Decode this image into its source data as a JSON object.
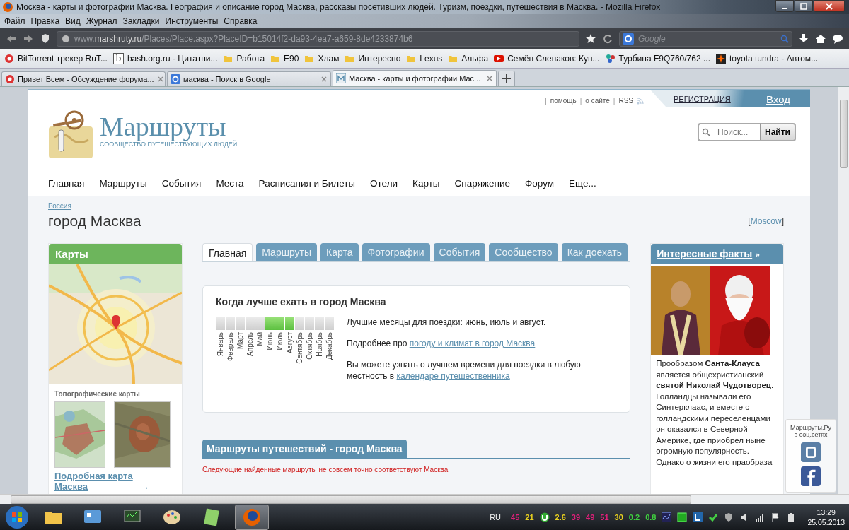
{
  "window": {
    "title": "Москва - карты и фотографии Масква. География и описание город Масква, рассказы посетивших людей. Туризм, поездки, путешествия в Масква. - Mozilla Firefox"
  },
  "menu": [
    "Файл",
    "Правка",
    "Вид",
    "Журнал",
    "Закладки",
    "Инструменты",
    "Справка"
  ],
  "address": {
    "prefix": "www.",
    "domain": "marshruty.ru",
    "path": "/Places/Place.aspx?PlaceID=b15014f2-da93-4ea7-a659-8de4233874b6"
  },
  "web_search": {
    "placeholder": "Google"
  },
  "bookmarks": [
    {
      "label": "BitTorrent трекер RuT...",
      "kind": "flower"
    },
    {
      "label": "bash.org.ru - Цитатни...",
      "kind": "letter",
      "glyph": "b"
    },
    {
      "label": "Работа",
      "kind": "folder"
    },
    {
      "label": "E90",
      "kind": "folder"
    },
    {
      "label": "Хлам",
      "kind": "folder"
    },
    {
      "label": "Интересно",
      "kind": "folder"
    },
    {
      "label": "Lexus",
      "kind": "folder"
    },
    {
      "label": "Альфа",
      "kind": "folder"
    },
    {
      "label": "Семён Слепаков: Куп...",
      "kind": "video"
    },
    {
      "label": "Турбина F9Q760/762 ...",
      "kind": "dots"
    },
    {
      "label": "toyota tundra - Автом...",
      "kind": "star"
    }
  ],
  "tabs": [
    {
      "label": "Привет Всем - Обсуждение форума...",
      "kind": "flower",
      "selected": false
    },
    {
      "label": "масква - Поиск в Google",
      "kind": "google",
      "selected": false
    },
    {
      "label": "Масква - карты и фотографии Мас...",
      "kind": "site",
      "selected": true
    }
  ],
  "site": {
    "separator": "|",
    "top_links": [
      "помощь",
      "о сайте",
      "RSS"
    ],
    "register": "РЕГИСТРАЦИЯ",
    "login": "Вход",
    "logo": "Маршруты",
    "tagline": "СООБЩЕСТВО ПУТЕШЕСТВУЮЩИХ ЛЮДЕЙ",
    "search": {
      "placeholder": "Поиск...",
      "button": "Найти"
    },
    "nav": [
      "Главная",
      "Маршруты",
      "События",
      "Места",
      "Расписания и Билеты",
      "Отели",
      "Карты",
      "Снаряжение",
      "Форум",
      "Еще..."
    ],
    "breadcrumb": "Россия",
    "heading": "город Масква",
    "alt_name": {
      "open": "[",
      "link": "Moscow",
      "close": "]"
    }
  },
  "maps_box": {
    "title": "Карты",
    "topo_title": "Топографические карты",
    "link": "Подробная карта Масква",
    "link_arrow": "→"
  },
  "place_tabs": [
    {
      "label": "Главная",
      "selected": true
    },
    {
      "label": "Маршруты",
      "selected": false
    },
    {
      "label": "Карта",
      "selected": false
    },
    {
      "label": "Фотографии",
      "selected": false
    },
    {
      "label": "События",
      "selected": false
    },
    {
      "label": "Сообщество",
      "selected": false
    },
    {
      "label": "Как доехать",
      "selected": false
    }
  ],
  "best_time": {
    "title": "Когда лучше ехать в город Масква",
    "months": [
      {
        "label": "Январь",
        "best": false
      },
      {
        "label": "Февраль",
        "best": false
      },
      {
        "label": "Март",
        "best": false
      },
      {
        "label": "Апрель",
        "best": false
      },
      {
        "label": "Май",
        "best": false
      },
      {
        "label": "Июнь",
        "best": true
      },
      {
        "label": "Июль",
        "best": true
      },
      {
        "label": "Август",
        "best": true
      },
      {
        "label": "Сентябрь",
        "best": false
      },
      {
        "label": "Октябрь",
        "best": false
      },
      {
        "label": "Ноябрь",
        "best": false
      },
      {
        "label": "Декабрь",
        "best": false
      }
    ],
    "summary": "Лучшие месяцы для поездки: июнь, июль и август.",
    "more_text": "Подробнее про",
    "more_link": "погоду и климат в город Масква",
    "calendar_text": "Вы можете узнать о лучшем времени для поездки в любую местность в",
    "calendar_link": "календаре путешественника"
  },
  "routes": {
    "title": "Маршруты путешествий - город Масква",
    "notice": "Следующие найденные маршруты не совсем точно соответствуют Масква"
  },
  "facts": {
    "title": "Интересные факты",
    "more": "»",
    "text": "Прообразом **Санта-Клауса** является общехристианский **святой Николай Чудотворец**. Голландцы называли его Синтерклаас, и вместе с голландскими переселенцами он оказался в Северной Америке, где приобрел ныне огромную популярность. Однако о жизни его праобраза"
  },
  "social": {
    "title": "Маршруты.Ру в соц.сетях"
  },
  "taskbar": {
    "language": "RU",
    "readings_a": [
      {
        "text": "45",
        "color": "#e0207a"
      },
      {
        "text": "21",
        "color": "#e8d020"
      }
    ],
    "readings_b": [
      {
        "text": "2.6",
        "color": "#e8d020"
      },
      {
        "text": "39",
        "color": "#e0207a"
      },
      {
        "text": "49",
        "color": "#e0207a"
      },
      {
        "text": "51",
        "color": "#e0207a"
      },
      {
        "text": "30",
        "color": "#e8d020"
      },
      {
        "text": "0.2",
        "color": "#40d040"
      },
      {
        "text": "0.8",
        "color": "#40d040"
      }
    ],
    "time": "13:29",
    "date": "25.05.2013"
  }
}
